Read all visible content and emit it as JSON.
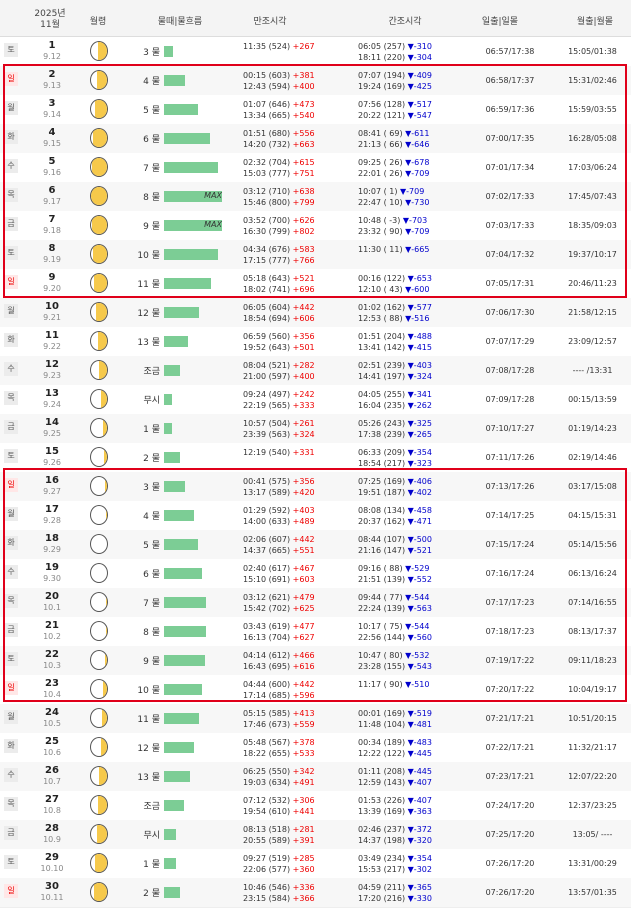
{
  "header": {
    "year": "2025년",
    "month": "11월",
    "phase": "월령",
    "tide": "물때|물흐름",
    "high": "만조시각",
    "low": "간조시각",
    "sun": "일출|일몰",
    "moon": "월출|월몰"
  },
  "rows": [
    {
      "dow": "토",
      "sun": false,
      "day": "1",
      "lunar": "9.12",
      "lit": 0.58,
      "tcnt": "3 물",
      "bar": 0.15,
      "max": "",
      "hi": [
        [
          "11:35 (524) ",
          "+267",
          ""
        ]
      ],
      "lo": [
        [
          "06:05 (257) ",
          "▼-310"
        ],
        [
          "18:11 (220) ",
          "▼-304"
        ]
      ],
      "sunt": "06:57/17:38",
      "mnt": "15:05/01:38"
    },
    {
      "dow": "일",
      "sun": true,
      "day": "2",
      "lunar": "9.13",
      "lit": 0.65,
      "tcnt": "4 물",
      "bar": 0.37,
      "max": "",
      "hi": [
        [
          "00:15 (603) ",
          "+381"
        ],
        [
          "12:43 (594) ",
          "+400"
        ]
      ],
      "lo": [
        [
          "07:07 (194) ",
          "▼-409"
        ],
        [
          "19:24 (169) ",
          "▼-425"
        ]
      ],
      "sunt": "06:58/17:37",
      "mnt": "15:31/02:46"
    },
    {
      "dow": "월",
      "sun": false,
      "day": "3",
      "lunar": "9.14",
      "lit": 0.74,
      "tcnt": "5 물",
      "bar": 0.58,
      "max": "",
      "hi": [
        [
          "01:07 (646) ",
          "+473"
        ],
        [
          "13:34 (665) ",
          "+540"
        ]
      ],
      "lo": [
        [
          "07:56 (128) ",
          "▼-517"
        ],
        [
          "20:22 (121) ",
          "▼-547"
        ]
      ],
      "sunt": "06:59/17:36",
      "mnt": "15:59/03:55"
    },
    {
      "dow": "화",
      "sun": false,
      "day": "4",
      "lunar": "9.15",
      "lit": 0.86,
      "tcnt": "6 물",
      "bar": 0.79,
      "max": "",
      "hi": [
        [
          "01:51 (680) ",
          "+556"
        ],
        [
          "14:20 (732) ",
          "+663"
        ]
      ],
      "lo": [
        [
          "08:41 ( 69) ",
          "▼-611"
        ],
        [
          "21:13 ( 66) ",
          "▼-646"
        ]
      ],
      "sunt": "07:00/17:35",
      "mnt": "16:28/05:08"
    },
    {
      "dow": "수",
      "sun": false,
      "day": "5",
      "lunar": "9.16",
      "lit": 0.95,
      "tcnt": "7 물",
      "bar": 0.93,
      "max": "",
      "hi": [
        [
          "02:32 (704) ",
          "+615"
        ],
        [
          "15:03 (777) ",
          "+751"
        ]
      ],
      "lo": [
        [
          "09:25 ( 26) ",
          "▼-678"
        ],
        [
          "22:01 ( 26) ",
          "▼-709"
        ]
      ],
      "sunt": "07:01/17:34",
      "mnt": "17:03/06:24"
    },
    {
      "dow": "목",
      "sun": false,
      "day": "6",
      "lunar": "9.17",
      "lit": 1.0,
      "tcnt": "8 물",
      "bar": 1.0,
      "max": "MAX",
      "hi": [
        [
          "03:12 (710) ",
          "+638"
        ],
        [
          "15:46 (800) ",
          "+799"
        ]
      ],
      "lo": [
        [
          "10:07 ( 1) ",
          "▼-709"
        ],
        [
          "22:47 ( 10) ",
          "▼-730"
        ]
      ],
      "sunt": "07:02/17:33",
      "mnt": "17:45/07:43"
    },
    {
      "dow": "금",
      "sun": false,
      "day": "7",
      "lunar": "9.18",
      "lit": 0.95,
      "tcnt": "9 물",
      "bar": 1.0,
      "max": "MAX",
      "hi": [
        [
          "03:52 (700) ",
          "+626"
        ],
        [
          "16:30 (799) ",
          "+802"
        ]
      ],
      "lo": [
        [
          "10:48 ( -3) ",
          "▼-703"
        ],
        [
          "23:32 ( 90) ",
          "▼-709"
        ]
      ],
      "sunt": "07:03/17:33",
      "mnt": "18:35/09:03"
    },
    {
      "dow": "토",
      "sun": false,
      "day": "8",
      "lunar": "9.19",
      "lit": 0.88,
      "tcnt": "10 물",
      "bar": 0.93,
      "max": "",
      "hi": [
        [
          "04:34 (676) ",
          "+583"
        ],
        [
          "17:15 (777) ",
          "+766"
        ]
      ],
      "lo": [
        [
          "11:30 ( 11) ",
          "▼-665"
        ]
      ],
      "sunt": "07:04/17:32",
      "mnt": "19:37/10:17"
    },
    {
      "dow": "일",
      "sun": true,
      "day": "9",
      "lunar": "9.20",
      "lit": 0.8,
      "tcnt": "11 물",
      "bar": 0.81,
      "max": "",
      "hi": [
        [
          "05:18 (643) ",
          "+521"
        ],
        [
          "18:02 (741) ",
          "+696"
        ]
      ],
      "lo": [
        [
          "00:16 (122) ",
          "▼-653"
        ],
        [
          "12:10 ( 43) ",
          "▼-600"
        ]
      ],
      "sunt": "07:05/17:31",
      "mnt": "20:46/11:23"
    },
    {
      "dow": "월",
      "sun": false,
      "day": "10",
      "lunar": "9.21",
      "lit": 0.7,
      "tcnt": "12 물",
      "bar": 0.6,
      "max": "",
      "hi": [
        [
          "06:05 (604) ",
          "+442"
        ],
        [
          "18:54 (694) ",
          "+606"
        ]
      ],
      "lo": [
        [
          "01:02 (162) ",
          "▼-577"
        ],
        [
          "12:53 ( 88) ",
          "▼-516"
        ]
      ],
      "sunt": "07:06/17:30",
      "mnt": "21:58/12:15"
    },
    {
      "dow": "화",
      "sun": false,
      "day": "11",
      "lunar": "9.22",
      "lit": 0.58,
      "tcnt": "13 물",
      "bar": 0.42,
      "max": "",
      "hi": [
        [
          "06:59 (560) ",
          "+356"
        ],
        [
          "19:52 (643) ",
          "+501"
        ]
      ],
      "lo": [
        [
          "01:51 (204) ",
          "▼-488"
        ],
        [
          "13:41 (142) ",
          "▼-415"
        ]
      ],
      "sunt": "07:07/17:29",
      "mnt": "23:09/12:57"
    },
    {
      "dow": "수",
      "sun": false,
      "day": "12",
      "lunar": "9.23",
      "lit": 0.47,
      "tcnt": "조금",
      "bar": 0.28,
      "max": "",
      "hi": [
        [
          "08:04 (521) ",
          "+282"
        ],
        [
          "21:00 (597) ",
          "+400"
        ]
      ],
      "lo": [
        [
          "02:51 (239) ",
          "▼-403"
        ],
        [
          "14:41 (197) ",
          "▼-324"
        ]
      ],
      "sunt": "07:08/17:28",
      "mnt": "---- /13:31"
    },
    {
      "dow": "목",
      "sun": false,
      "day": "13",
      "lunar": "9.24",
      "lit": 0.38,
      "tcnt": "무시",
      "bar": 0.14,
      "max": "",
      "hi": [
        [
          "09:24 (497) ",
          "+242"
        ],
        [
          "22:19 (565) ",
          "+333"
        ]
      ],
      "lo": [
        [
          "04:05 (255) ",
          "▼-341"
        ],
        [
          "16:04 (235) ",
          "▼-262"
        ]
      ],
      "sunt": "07:09/17:28",
      "mnt": "00:15/13:59"
    },
    {
      "dow": "금",
      "sun": false,
      "day": "14",
      "lunar": "9.25",
      "lit": 0.28,
      "tcnt": "1 물",
      "bar": 0.14,
      "max": "",
      "hi": [
        [
          "10:57 (504) ",
          "+261"
        ],
        [
          "23:39 (563) ",
          "+324"
        ]
      ],
      "lo": [
        [
          "05:26 (243) ",
          "▼-325"
        ],
        [
          "17:38 (239) ",
          "▼-265"
        ]
      ],
      "sunt": "07:10/17:27",
      "mnt": "01:19/14:23"
    },
    {
      "dow": "토",
      "sun": false,
      "day": "15",
      "lunar": "9.26",
      "lit": 0.2,
      "tcnt": "2 물",
      "bar": 0.28,
      "max": "",
      "hi": [
        [
          "12:19 (540) ",
          "+331"
        ]
      ],
      "lo": [
        [
          "06:33 (209) ",
          "▼-354"
        ],
        [
          "18:54 (217) ",
          "▼-323"
        ]
      ],
      "sunt": "07:11/17:26",
      "mnt": "02:19/14:46"
    },
    {
      "dow": "일",
      "sun": true,
      "day": "16",
      "lunar": "9.27",
      "lit": 0.13,
      "tcnt": "3 물",
      "bar": 0.37,
      "max": "",
      "hi": [
        [
          "00:41 (575) ",
          "+356"
        ],
        [
          "13:17 (589) ",
          "+420"
        ]
      ],
      "lo": [
        [
          "07:25 (169) ",
          "▼-406"
        ],
        [
          "19:51 (187) ",
          "▼-402"
        ]
      ],
      "sunt": "07:13/17:26",
      "mnt": "03:17/15:08"
    },
    {
      "dow": "월",
      "sun": false,
      "day": "17",
      "lunar": "9.28",
      "lit": 0.07,
      "tcnt": "4 물",
      "bar": 0.51,
      "max": "",
      "hi": [
        [
          "01:29 (592) ",
          "+403"
        ],
        [
          "14:00 (633) ",
          "+489"
        ]
      ],
      "lo": [
        [
          "08:08 (134) ",
          "▼-458"
        ],
        [
          "20:37 (162) ",
          "▼-471"
        ]
      ],
      "sunt": "07:14/17:25",
      "mnt": "04:15/15:31"
    },
    {
      "dow": "화",
      "sun": false,
      "day": "18",
      "lunar": "9.29",
      "lit": 0.03,
      "tcnt": "5 물",
      "bar": 0.58,
      "max": "",
      "hi": [
        [
          "02:06 (607) ",
          "+442"
        ],
        [
          "14:37 (665) ",
          "+551"
        ]
      ],
      "lo": [
        [
          "08:44 (107) ",
          "▼-500"
        ],
        [
          "21:16 (147) ",
          "▼-521"
        ]
      ],
      "sunt": "07:15/17:24",
      "mnt": "05:14/15:56"
    },
    {
      "dow": "수",
      "sun": false,
      "day": "19",
      "lunar": "9.30",
      "lit": 0.0,
      "tcnt": "6 물",
      "bar": 0.65,
      "max": "",
      "hi": [
        [
          "02:40 (617) ",
          "+467"
        ],
        [
          "15:10 (691) ",
          "+603"
        ]
      ],
      "lo": [
        [
          "09:16 ( 88) ",
          "▼-529"
        ],
        [
          "21:51 (139) ",
          "▼-552"
        ]
      ],
      "sunt": "07:16/17:24",
      "mnt": "06:13/16:24"
    },
    {
      "dow": "목",
      "sun": false,
      "day": "20",
      "lunar": "10.1",
      "lit": 0.04,
      "tcnt": "7 물",
      "bar": 0.72,
      "max": "",
      "hi": [
        [
          "03:12 (621) ",
          "+479"
        ],
        [
          "15:42 (702) ",
          "+625"
        ]
      ],
      "lo": [
        [
          "09:44 ( 77) ",
          "▼-544"
        ],
        [
          "22:24 (139) ",
          "▼-563"
        ]
      ],
      "sunt": "07:17/17:23",
      "mnt": "07:14/16:55"
    },
    {
      "dow": "금",
      "sun": false,
      "day": "21",
      "lunar": "10.2",
      "lit": 0.08,
      "tcnt": "8 물",
      "bar": 0.72,
      "max": "",
      "hi": [
        [
          "03:43 (619) ",
          "+477"
        ],
        [
          "16:13 (704) ",
          "+627"
        ]
      ],
      "lo": [
        [
          "10:17 ( 75) ",
          "▼-544"
        ],
        [
          "22:56 (144) ",
          "▼-560"
        ]
      ],
      "sunt": "07:18/17:23",
      "mnt": "08:13/17:37"
    },
    {
      "dow": "토",
      "sun": false,
      "day": "22",
      "lunar": "10.3",
      "lit": 0.14,
      "tcnt": "9 물",
      "bar": 0.7,
      "max": "",
      "hi": [
        [
          "04:14 (612) ",
          "+466"
        ],
        [
          "16:43 (695) ",
          "+616"
        ]
      ],
      "lo": [
        [
          "10:47 ( 80) ",
          "▼-532"
        ],
        [
          "23:28 (155) ",
          "▼-543"
        ]
      ],
      "sunt": "07:19/17:22",
      "mnt": "09:11/18:23"
    },
    {
      "dow": "일",
      "sun": true,
      "day": "23",
      "lunar": "10.4",
      "lit": 0.22,
      "tcnt": "10 물",
      "bar": 0.65,
      "max": "",
      "hi": [
        [
          "04:44 (600) ",
          "+442"
        ],
        [
          "17:14 (685) ",
          "+596"
        ]
      ],
      "lo": [
        [
          "11:17 ( 90) ",
          "▼-510"
        ]
      ],
      "sunt": "07:20/17:22",
      "mnt": "10:04/19:17"
    },
    {
      "dow": "월",
      "sun": false,
      "day": "24",
      "lunar": "10.5",
      "lit": 0.3,
      "tcnt": "11 물",
      "bar": 0.6,
      "max": "",
      "hi": [
        [
          "05:15 (585) ",
          "+413"
        ],
        [
          "17:46 (673) ",
          "+559"
        ]
      ],
      "lo": [
        [
          "00:01 (169) ",
          "▼-519"
        ],
        [
          "11:48 (104) ",
          "▼-481"
        ]
      ],
      "sunt": "07:21/17:21",
      "mnt": "10:51/20:15"
    },
    {
      "dow": "화",
      "sun": false,
      "day": "25",
      "lunar": "10.6",
      "lit": 0.38,
      "tcnt": "12 물",
      "bar": 0.51,
      "max": "",
      "hi": [
        [
          "05:48 (567) ",
          "+378"
        ],
        [
          "18:22 (655) ",
          "+533"
        ]
      ],
      "lo": [
        [
          "00:34 (189) ",
          "▼-483"
        ],
        [
          "12:22 (122) ",
          "▼-445"
        ]
      ],
      "sunt": "07:22/17:21",
      "mnt": "11:32/21:17"
    },
    {
      "dow": "수",
      "sun": false,
      "day": "26",
      "lunar": "10.7",
      "lit": 0.47,
      "tcnt": "13 물",
      "bar": 0.45,
      "max": "",
      "hi": [
        [
          "06:25 (550) ",
          "+342"
        ],
        [
          "19:03 (634) ",
          "+491"
        ]
      ],
      "lo": [
        [
          "01:11 (208) ",
          "▼-445"
        ],
        [
          "12:59 (143) ",
          "▼-407"
        ]
      ],
      "sunt": "07:23/17:21",
      "mnt": "12:07/22:20"
    },
    {
      "dow": "목",
      "sun": false,
      "day": "27",
      "lunar": "10.8",
      "lit": 0.55,
      "tcnt": "조금",
      "bar": 0.35,
      "max": "",
      "hi": [
        [
          "07:12 (532) ",
          "+306"
        ],
        [
          "19:54 (610) ",
          "+441"
        ]
      ],
      "lo": [
        [
          "01:53 (226) ",
          "▼-407"
        ],
        [
          "13:39 (169) ",
          "▼-363"
        ]
      ],
      "sunt": "07:24/17:20",
      "mnt": "12:37/23:25"
    },
    {
      "dow": "금",
      "sun": false,
      "day": "28",
      "lunar": "10.9",
      "lit": 0.63,
      "tcnt": "무시",
      "bar": 0.21,
      "max": "",
      "hi": [
        [
          "08:13 (518) ",
          "+281"
        ],
        [
          "20:55 (589) ",
          "+391"
        ]
      ],
      "lo": [
        [
          "02:46 (237) ",
          "▼-372"
        ],
        [
          "14:37 (198) ",
          "▼-320"
        ]
      ],
      "sunt": "07:25/17:20",
      "mnt": "13:05/ ----"
    },
    {
      "dow": "토",
      "sun": false,
      "day": "29",
      "lunar": "10.10",
      "lit": 0.72,
      "tcnt": "1 물",
      "bar": 0.2,
      "max": "",
      "hi": [
        [
          "09:27 (519) ",
          "+285"
        ],
        [
          "22:06 (577) ",
          "+360"
        ]
      ],
      "lo": [
        [
          "03:49 (234) ",
          "▼-354"
        ],
        [
          "15:53 (217) ",
          "▼-302"
        ]
      ],
      "sunt": "07:26/17:20",
      "mnt": "13:31/00:29"
    },
    {
      "dow": "일",
      "sun": true,
      "day": "30",
      "lunar": "10.11",
      "lit": 0.8,
      "tcnt": "2 물",
      "bar": 0.28,
      "max": "",
      "hi": [
        [
          "10:46 (546) ",
          "+336"
        ],
        [
          "23:15 (584) ",
          "+366"
        ]
      ],
      "lo": [
        [
          "04:59 (211) ",
          "▼-365"
        ],
        [
          "17:20 (216) ",
          "▼-330"
        ]
      ],
      "sunt": "07:26/17:20",
      "mnt": "13:57/01:35"
    }
  ]
}
